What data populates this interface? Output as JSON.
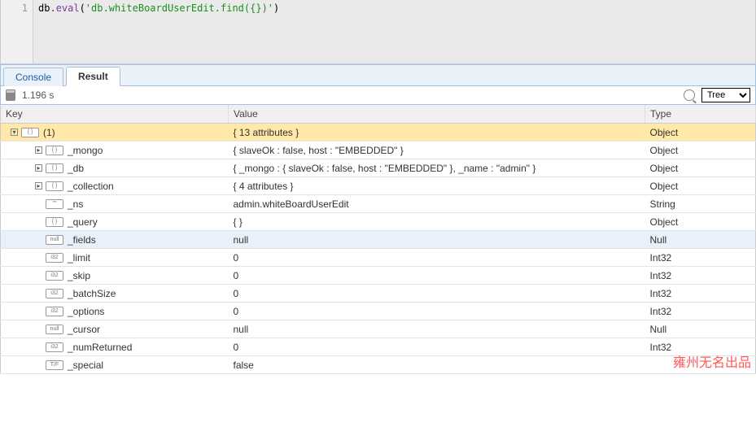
{
  "editor": {
    "line_number": "1",
    "code_obj": "db",
    "code_dot1": ".",
    "code_method": "eval",
    "code_open": "(",
    "code_str": "'db.whiteBoardUserEdit.find({})'",
    "code_close": ")"
  },
  "tabs": {
    "console": "Console",
    "result": "Result"
  },
  "toolbar": {
    "time": "1.196 s",
    "view_mode": "Tree"
  },
  "columns": {
    "key": "Key",
    "value": "Value",
    "type": "Type"
  },
  "rows": [
    {
      "indent": 0,
      "toggle": "exp",
      "icon": "{ }",
      "key": "(1)",
      "value": "{ 13 attributes }",
      "type": "Object",
      "selected": true
    },
    {
      "indent": 1,
      "toggle": "col",
      "icon": "{ }",
      "key": "_mongo",
      "value": "{ slaveOk : false, host : \"EMBEDDED\" }",
      "type": "Object"
    },
    {
      "indent": 1,
      "toggle": "col",
      "icon": "{ }",
      "key": "_db",
      "value": "{ _mongo : { slaveOk : false, host : \"EMBEDDED\" }, _name : \"admin\" }",
      "type": "Object"
    },
    {
      "indent": 1,
      "toggle": "col",
      "icon": "{ }",
      "key": "_collection",
      "value": "{ 4 attributes }",
      "type": "Object"
    },
    {
      "indent": 1,
      "toggle": "blank",
      "icon": "\"\"",
      "key": "_ns",
      "value": "admin.whiteBoardUserEdit",
      "type": "String"
    },
    {
      "indent": 1,
      "toggle": "blank",
      "icon": "{ }",
      "key": "_query",
      "value": "{ }",
      "type": "Object"
    },
    {
      "indent": 1,
      "toggle": "blank",
      "icon": "null",
      "key": "_fields",
      "value": "null",
      "type": "Null",
      "hover": true
    },
    {
      "indent": 1,
      "toggle": "blank",
      "icon": "i32",
      "key": "_limit",
      "value": "0",
      "type": "Int32"
    },
    {
      "indent": 1,
      "toggle": "blank",
      "icon": "i32",
      "key": "_skip",
      "value": "0",
      "type": "Int32"
    },
    {
      "indent": 1,
      "toggle": "blank",
      "icon": "i32",
      "key": "_batchSize",
      "value": "0",
      "type": "Int32"
    },
    {
      "indent": 1,
      "toggle": "blank",
      "icon": "i32",
      "key": "_options",
      "value": "0",
      "type": "Int32"
    },
    {
      "indent": 1,
      "toggle": "blank",
      "icon": "null",
      "key": "_cursor",
      "value": "null",
      "type": "Null"
    },
    {
      "indent": 1,
      "toggle": "blank",
      "icon": "i32",
      "key": "_numReturned",
      "value": "0",
      "type": "Int32"
    },
    {
      "indent": 1,
      "toggle": "blank",
      "icon": "T/F",
      "key": "_special",
      "value": "false",
      "type": ""
    }
  ],
  "watermark": "雍州无名出品"
}
